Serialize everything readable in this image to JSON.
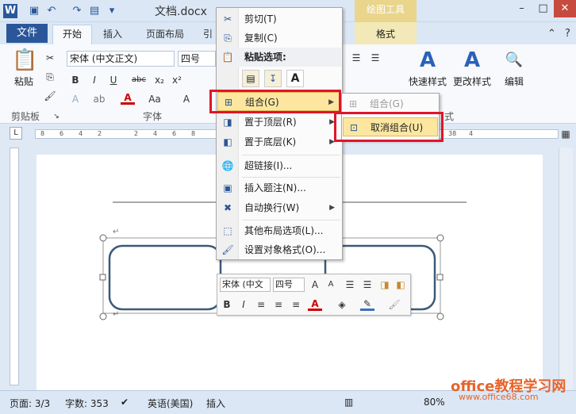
{
  "window": {
    "title": "文档.docx",
    "contextual_tab_group": "绘图工具"
  },
  "tabs": [
    "文件",
    "开始",
    "插入",
    "页面布局",
    "引"
  ],
  "format_tab": "格式",
  "ribbon": {
    "font_name": "宋体 (中文正文)",
    "font_size": "四号",
    "paste_label": "粘贴",
    "quick_styles_label": "快速样式",
    "change_styles_label": "更改样式",
    "edit_label": "编辑",
    "groups": {
      "clipboard": "剪贴板",
      "font": "字体",
      "styles": "式"
    }
  },
  "ruler": {
    "ticks": [
      "8",
      "6",
      "4",
      "2",
      "2",
      "4",
      "6",
      "8",
      "38",
      "4"
    ]
  },
  "context_menu": {
    "items": [
      {
        "label": "剪切(T)",
        "icon": "scissors-icon"
      },
      {
        "label": "复制(C)",
        "icon": "copy-icon"
      },
      {
        "label": "粘贴选项:",
        "icon": "paste-icon"
      },
      {
        "label": "组合(G)",
        "icon": "group-icon",
        "submenu": true
      },
      {
        "label": "置于顶层(R)",
        "icon": "bring-front-icon",
        "submenu": true
      },
      {
        "label": "置于底层(K)",
        "icon": "send-back-icon",
        "submenu": true
      },
      {
        "label": "超链接(I)...",
        "icon": "hyperlink-icon"
      },
      {
        "label": "插入题注(N)...",
        "icon": "caption-icon"
      },
      {
        "label": "自动换行(W)",
        "icon": "wrap-icon",
        "submenu": true
      },
      {
        "label": "其他布局选项(L)...",
        "icon": "layout-icon"
      },
      {
        "label": "设置对象格式(O)...",
        "icon": "format-object-icon"
      }
    ]
  },
  "submenu": {
    "items": [
      {
        "label": "组合(G)",
        "enabled": false
      },
      {
        "label": "取消组合(U)",
        "enabled": true
      }
    ]
  },
  "mini_toolbar": {
    "font_name": "宋体 (中文",
    "font_size": "四号"
  },
  "status": {
    "page": "页面: 3/3",
    "words": "字数: 353",
    "language": "英语(美国)",
    "mode": "插入",
    "zoom": "80%"
  },
  "watermark": {
    "title": "office教程学习网",
    "url": "www.office68.com"
  },
  "colors": {
    "accent": "#2b579a",
    "highlight": "#fde7a0",
    "annotation_red": "#e0152a"
  }
}
